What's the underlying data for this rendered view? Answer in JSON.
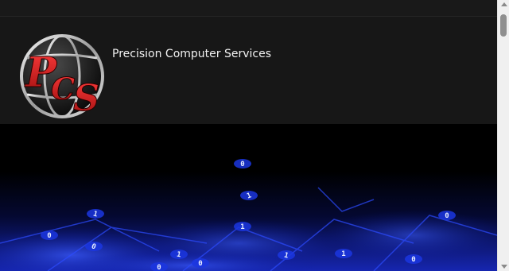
{
  "header": {
    "site_title": "Precision Computer Services",
    "logo_icon": "pcs-globe-logo"
  },
  "hero": {
    "digits": [
      "0",
      "1",
      "1",
      "0",
      "0",
      "1",
      "0",
      "1",
      "0",
      "1",
      "1",
      "0",
      "0"
    ]
  },
  "colors": {
    "header_bg": "#171717",
    "top_strip_bg": "#191919",
    "logo_red": "#c81e1e",
    "hero_blue": "#2a4dff"
  }
}
